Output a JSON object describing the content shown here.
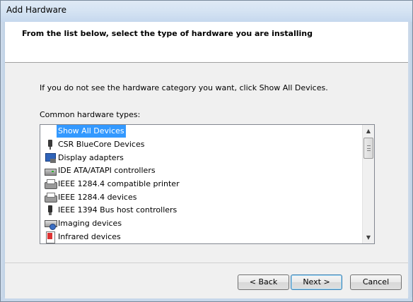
{
  "window": {
    "title": "Add Hardware"
  },
  "header": {
    "heading": "From the list below, select the type of hardware you are installing"
  },
  "main": {
    "instruction": "If you do not see the hardware category you want, click Show All Devices.",
    "list_label": "Common hardware types:",
    "items": [
      {
        "label": "Show All Devices",
        "icon": "none",
        "selected": true
      },
      {
        "label": "CSR BlueCore Devices",
        "icon": "usb-device-icon"
      },
      {
        "label": "Display adapters",
        "icon": "display-adapter-icon"
      },
      {
        "label": "IDE ATA/ATAPI controllers",
        "icon": "ide-controller-icon"
      },
      {
        "label": "IEEE 1284.4 compatible printer",
        "icon": "printer-icon"
      },
      {
        "label": "IEEE 1284.4 devices",
        "icon": "printer-icon"
      },
      {
        "label": "IEEE 1394 Bus host controllers",
        "icon": "firewire-icon"
      },
      {
        "label": "Imaging devices",
        "icon": "imaging-device-icon"
      },
      {
        "label": "Infrared devices",
        "icon": "infrared-icon"
      }
    ],
    "scroll": {
      "position": 0.05
    }
  },
  "footer": {
    "back_label": "< Back",
    "next_label": "Next >",
    "cancel_label": "Cancel"
  },
  "colors": {
    "selection": "#3399ff",
    "titlebar": "#d6e4f3",
    "dialog_bg": "#f0f0f0"
  }
}
